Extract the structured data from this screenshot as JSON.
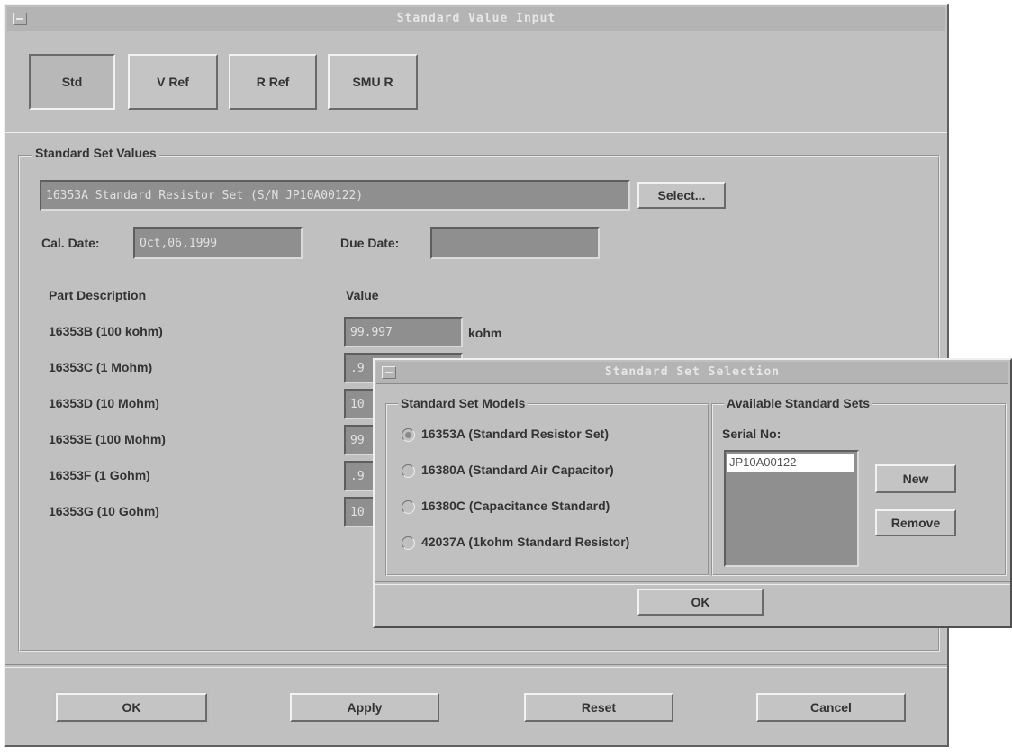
{
  "window": {
    "title": "Standard Value Input",
    "tabs": [
      "Std",
      "V Ref",
      "R Ref",
      "SMU R"
    ]
  },
  "std_set": {
    "group_label": "Standard Set Values",
    "set_name": "16353A Standard Resistor Set (S/N JP10A00122)",
    "select_label": "Select...",
    "cal_date_label": "Cal. Date:",
    "cal_date_value": "Oct,06,1999",
    "due_date_label": "Due Date:",
    "due_date_value": "",
    "col_part": "Part Description",
    "col_value": "Value",
    "rows": [
      {
        "part": "16353B (100 kohm)",
        "value": "99.997",
        "unit": "kohm"
      },
      {
        "part": "16353C (1 Mohm)",
        "value": ".9",
        "unit": ""
      },
      {
        "part": "16353D (10 Mohm)",
        "value": "10",
        "unit": ""
      },
      {
        "part": "16353E (100 Mohm)",
        "value": "99",
        "unit": ""
      },
      {
        "part": "16353F (1 Gohm)",
        "value": ".9",
        "unit": ""
      },
      {
        "part": "16353G (10 Gohm)",
        "value": "10",
        "unit": ""
      }
    ]
  },
  "bottom_buttons": {
    "ok": "OK",
    "apply": "Apply",
    "reset": "Reset",
    "cancel": "Cancel"
  },
  "dialog": {
    "title": "Standard Set Selection",
    "models_label": "Standard Set Models",
    "models": [
      {
        "label": "16353A (Standard Resistor Set)",
        "selected": true
      },
      {
        "label": "16380A (Standard Air Capacitor)",
        "selected": false
      },
      {
        "label": "16380C (Capacitance Standard)",
        "selected": false
      },
      {
        "label": "42037A (1kohm Standard Resistor)",
        "selected": false
      }
    ],
    "available_label": "Available Standard Sets",
    "serial_label": "Serial No:",
    "serials": [
      "JP10A00122"
    ],
    "new_label": "New",
    "remove_label": "Remove",
    "ok_label": "OK"
  }
}
